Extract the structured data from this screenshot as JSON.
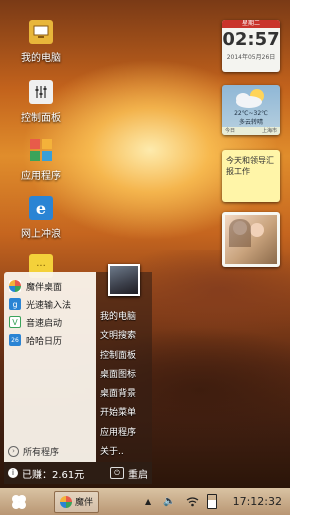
{
  "desktop_icons": [
    {
      "label": "我的电脑",
      "icon": "computer-icon",
      "color": "#e8b63a"
    },
    {
      "label": "控制面板",
      "icon": "control-panel-icon",
      "color": "#f0f0f0"
    },
    {
      "label": "应用程序",
      "icon": "apps-icon",
      "color": "#3a9fd8"
    },
    {
      "label": "网上冲浪",
      "icon": "ie-browser-icon",
      "color": "#2a84d4"
    },
    {
      "label": "",
      "icon": "chat-bubble-icon",
      "color": "#f4d13a"
    }
  ],
  "clock_widget": {
    "weekday": "星期二",
    "time": "02:57",
    "date": "2014年05月26日"
  },
  "weather_widget": {
    "temp": "22℃~32℃",
    "condition": "多云转晴",
    "day": "今日",
    "city": "上海市"
  },
  "note_widget": {
    "text": "今天和领导汇报工作"
  },
  "start_menu": {
    "apps": [
      {
        "label": "魔伴桌面",
        "icon": "pinwheel-icon",
        "color": "#e85b4a"
      },
      {
        "label": "光速输入法",
        "icon": "keyboard-icon",
        "color": "#2a84d4"
      },
      {
        "label": "音速启动",
        "icon": "v-launcher-icon",
        "color": "#3aa35a"
      },
      {
        "label": "哈哈日历",
        "icon": "calendar-icon",
        "color": "#2a84d4"
      }
    ],
    "all_programs": "所有程序",
    "links": [
      "我的电脑",
      "文明搜索",
      "控制面板",
      "桌面图标",
      "桌面背景",
      "开始菜单",
      "应用程序",
      "关于.."
    ],
    "earned": "已赚：2.61元",
    "restart": "重启"
  },
  "taskbar": {
    "app_label": "魔伴",
    "time": "17:12:32"
  }
}
